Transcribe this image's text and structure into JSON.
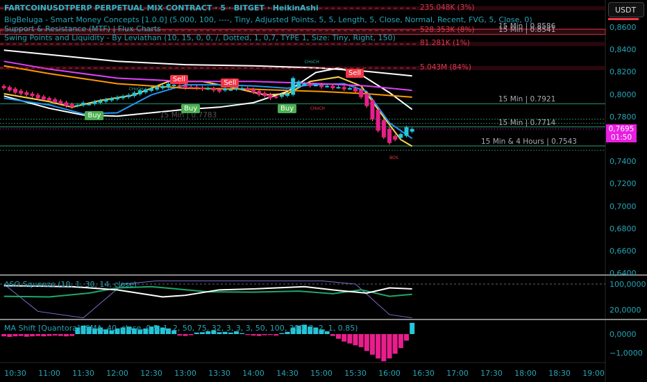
{
  "header": {
    "title": "FARTCOINUSDTPERP PERPETUAL MIX CONTRACT · 5 · BITGET · HeikinAshi",
    "indicators": [
      "BigBeluga - Smart Money Concepts [1.0.0] (5.000, 100, ----, Tiny, Adjusted Points, 5, 5, Length, 5, Close, Normal, Recent, FVG, 5, Close, 0)",
      "Support & Resistance (MTF) | Flux Charts",
      "Swing Points and Liquidity - By Leviathan (10, 15, 0, 0, /, Dotted, 1, 0,7, TYPE 1, Size: Tiny, Right, 150)"
    ]
  },
  "currency_button": "USDT",
  "current_price": {
    "value": "0,7695",
    "countdown": "01:50"
  },
  "liquidity_labels": [
    {
      "text": "235.048K (3%)",
      "price": 0.8775
    },
    {
      "text": "528.353K (8%)",
      "price": 0.8575
    },
    {
      "text": "81.281K (1%)",
      "price": 0.8455
    },
    {
      "text": "5.043M (84%)",
      "price": 0.824
    }
  ],
  "levels": [
    {
      "text": "15 Min | 0.8586",
      "price": 0.8586
    },
    {
      "text": "15 Min | 0.8541",
      "price": 0.8541
    },
    {
      "text": "15 Min | 0.7921",
      "price": 0.7921
    },
    {
      "text": "15 Min | 0.7714",
      "price": 0.7714
    },
    {
      "text": "15 Min & 4 Hours | 0.7543",
      "price": 0.7543
    },
    {
      "text": "15 Min | 0.7783",
      "price": 0.7783
    }
  ],
  "signals": [
    {
      "text": "Sell",
      "type": "sell",
      "time": "12:55",
      "price": 0.8125
    },
    {
      "text": "Sell",
      "type": "sell",
      "time": "13:40",
      "price": 0.8095
    },
    {
      "text": "Sell",
      "type": "sell",
      "time": "15:30",
      "price": 0.8185
    },
    {
      "text": "Buy",
      "type": "buy",
      "time": "11:40",
      "price": 0.7805
    },
    {
      "text": "Buy",
      "type": "buy",
      "time": "13:05",
      "price": 0.787
    },
    {
      "text": "Buy",
      "type": "buy",
      "time": "14:30",
      "price": 0.7865
    }
  ],
  "structure_labels": [
    {
      "text": "CHoCH",
      "time": "14:50",
      "price": 0.829,
      "color": "#26a69a"
    },
    {
      "text": "CHoCH",
      "time": "12:15",
      "price": 0.805,
      "color": "#26a69a"
    },
    {
      "text": "CHoCH",
      "time": "14:55",
      "price": 0.7875,
      "color": "#f23645"
    },
    {
      "text": "BOS",
      "time": "16:05",
      "price": 0.743,
      "color": "#f23645"
    }
  ],
  "panes": {
    "aso_label": "ASO Squeeze (10, 1, 30, 14, close)",
    "ma_label": "MA Shift [Quantora] (SMA, 40, close, 0.5, 1, 2, 50, 75, 32, 3, 3, 3, 50, 100, 200, 2, 2, 1, 0.85)"
  },
  "chart_data": {
    "type": "candlestick",
    "price_axis": [
      "0,8600",
      "0,8400",
      "0,8200",
      "0,8000",
      "0,7800",
      "0,7600",
      "0,7400",
      "0,7200",
      "0,7000",
      "0,6800",
      "0,6600",
      "0,6400"
    ],
    "time_axis": [
      "10:30",
      "11:00",
      "11:30",
      "12:00",
      "12:30",
      "13:00",
      "13:30",
      "14:00",
      "14:30",
      "15:00",
      "15:30",
      "16:00",
      "16:30",
      "17:00",
      "17:30",
      "18:00",
      "18:30",
      "19:00"
    ],
    "ylim": [
      0.64,
      0.885
    ],
    "start": "10:20",
    "interval_min": 5,
    "closes": [
      0.806,
      0.804,
      0.802,
      0.801,
      0.8,
      0.799,
      0.797,
      0.796,
      0.795,
      0.793,
      0.792,
      0.79,
      0.789,
      0.791,
      0.793,
      0.792,
      0.794,
      0.795,
      0.796,
      0.797,
      0.798,
      0.799,
      0.8,
      0.802,
      0.804,
      0.805,
      0.806,
      0.807,
      0.808,
      0.81,
      0.809,
      0.808,
      0.806,
      0.807,
      0.806,
      0.805,
      0.806,
      0.804,
      0.803,
      0.806,
      0.805,
      0.807,
      0.806,
      0.804,
      0.802,
      0.8,
      0.799,
      0.797,
      0.798,
      0.8,
      0.801,
      0.815,
      0.812,
      0.81,
      0.808,
      0.809,
      0.807,
      0.808,
      0.806,
      0.807,
      0.805,
      0.806,
      0.803,
      0.798,
      0.79,
      0.778,
      0.768,
      0.762,
      0.757,
      0.76,
      0.765,
      0.771,
      0.7695
    ],
    "ma_lines": [
      {
        "name": "white",
        "color": "#ffffff",
        "points": [
          [
            "10:20",
            0.799
          ],
          [
            "11:00",
            0.788
          ],
          [
            "11:30",
            0.782
          ],
          [
            "12:00",
            0.781
          ],
          [
            "12:30",
            0.784
          ],
          [
            "13:00",
            0.787
          ],
          [
            "13:30",
            0.789
          ],
          [
            "14:00",
            0.793
          ],
          [
            "14:30",
            0.803
          ],
          [
            "14:55",
            0.82
          ],
          [
            "15:15",
            0.824
          ],
          [
            "15:35",
            0.818
          ],
          [
            "16:00",
            0.802
          ],
          [
            "16:20",
            0.787
          ]
        ]
      },
      {
        "name": "white-slow",
        "color": "#ffffff",
        "points": [
          [
            "10:20",
            0.84
          ],
          [
            "11:00",
            0.836
          ],
          [
            "12:00",
            0.83
          ],
          [
            "13:00",
            0.827
          ],
          [
            "14:00",
            0.826
          ],
          [
            "15:00",
            0.824
          ],
          [
            "15:40",
            0.821
          ],
          [
            "16:20",
            0.817
          ]
        ]
      },
      {
        "name": "yellow",
        "color": "#ffd54a",
        "points": [
          [
            "10:20",
            0.801
          ],
          [
            "11:00",
            0.794
          ],
          [
            "11:20",
            0.789
          ],
          [
            "11:45",
            0.795
          ],
          [
            "12:15",
            0.8
          ],
          [
            "12:45",
            0.812
          ],
          [
            "13:15",
            0.812
          ],
          [
            "13:40",
            0.807
          ],
          [
            "14:10",
            0.8
          ],
          [
            "14:30",
            0.801
          ],
          [
            "14:50",
            0.812
          ],
          [
            "15:15",
            0.816
          ],
          [
            "15:35",
            0.808
          ],
          [
            "15:55",
            0.78
          ],
          [
            "16:10",
            0.76
          ],
          [
            "16:20",
            0.754
          ]
        ]
      },
      {
        "name": "blue",
        "color": "#2196f3",
        "points": [
          [
            "10:20",
            0.797
          ],
          [
            "11:00",
            0.791
          ],
          [
            "11:30",
            0.783
          ],
          [
            "12:00",
            0.784
          ],
          [
            "12:30",
            0.8
          ],
          [
            "13:00",
            0.809
          ],
          [
            "13:30",
            0.809
          ],
          [
            "14:00",
            0.808
          ],
          [
            "14:30",
            0.806
          ],
          [
            "14:50",
            0.809
          ],
          [
            "15:20",
            0.81
          ],
          [
            "15:40",
            0.803
          ],
          [
            "16:00",
            0.775
          ],
          [
            "16:20",
            0.761
          ]
        ]
      },
      {
        "name": "magenta",
        "color": "#e040fb",
        "points": [
          [
            "10:20",
            0.83
          ],
          [
            "11:00",
            0.823
          ],
          [
            "12:00",
            0.815
          ],
          [
            "13:00",
            0.812
          ],
          [
            "14:00",
            0.812
          ],
          [
            "15:00",
            0.81
          ],
          [
            "15:40",
            0.808
          ],
          [
            "16:20",
            0.804
          ]
        ]
      },
      {
        "name": "orange",
        "color": "#ff9800",
        "points": [
          [
            "10:20",
            0.826
          ],
          [
            "11:00",
            0.819
          ],
          [
            "12:00",
            0.81
          ],
          [
            "13:00",
            0.806
          ],
          [
            "14:00",
            0.805
          ],
          [
            "15:00",
            0.803
          ],
          [
            "15:40",
            0.801
          ],
          [
            "16:20",
            0.798
          ]
        ]
      }
    ],
    "aso": {
      "ylim": [
        -10,
        120
      ],
      "white": [
        [
          "10:20",
          95
        ],
        [
          "11:20",
          92
        ],
        [
          "12:00",
          82
        ],
        [
          "12:40",
          60
        ],
        [
          "13:00",
          65
        ],
        [
          "13:30",
          82
        ],
        [
          "14:00",
          85
        ],
        [
          "14:45",
          92
        ],
        [
          "15:15",
          80
        ],
        [
          "15:40",
          72
        ],
        [
          "16:00",
          88
        ],
        [
          "16:20",
          85
        ]
      ],
      "green": [
        [
          "10:20",
          62
        ],
        [
          "11:00",
          60
        ],
        [
          "11:35",
          72
        ],
        [
          "12:00",
          88
        ],
        [
          "12:30",
          92
        ],
        [
          "13:20",
          76
        ],
        [
          "14:00",
          75
        ],
        [
          "14:40",
          78
        ],
        [
          "15:10",
          70
        ],
        [
          "15:35",
          82
        ],
        [
          "16:00",
          62
        ],
        [
          "16:20",
          68
        ]
      ],
      "purple": [
        [
          "10:20",
          100
        ],
        [
          "10:50",
          15
        ],
        [
          "11:30",
          -5
        ],
        [
          "12:05",
          100
        ],
        [
          "12:35",
          110
        ],
        [
          "15:00",
          110
        ],
        [
          "15:30",
          100
        ],
        [
          "16:00",
          5
        ],
        [
          "16:20",
          -5
        ]
      ]
    },
    "ma_shift": {
      "ylim": [
        -1.6,
        0.75
      ],
      "values": [
        -0.12,
        -0.15,
        -0.12,
        -0.1,
        -0.14,
        -0.12,
        -0.1,
        -0.12,
        -0.1,
        -0.08,
        -0.1,
        -0.12,
        -0.1,
        0.35,
        0.45,
        0.4,
        0.3,
        0.35,
        0.25,
        0.2,
        0.3,
        0.35,
        0.4,
        0.3,
        0.25,
        0.3,
        0.4,
        0.45,
        0.35,
        0.3,
        0.2,
        -0.08,
        -0.1,
        -0.06,
        0.08,
        0.1,
        0.15,
        0.2,
        0.1,
        0.12,
        0.08,
        0.15,
        0.05,
        -0.05,
        -0.08,
        -0.1,
        -0.06,
        -0.05,
        -0.08,
        0.05,
        0.12,
        0.35,
        0.45,
        0.5,
        0.4,
        0.35,
        0.25,
        0.15,
        -0.1,
        -0.25,
        -0.4,
        -0.5,
        -0.6,
        -0.7,
        -0.9,
        -1.1,
        -1.3,
        -1.45,
        -1.3,
        -1.05,
        -0.75,
        -0.35,
        0.6
      ]
    }
  }
}
